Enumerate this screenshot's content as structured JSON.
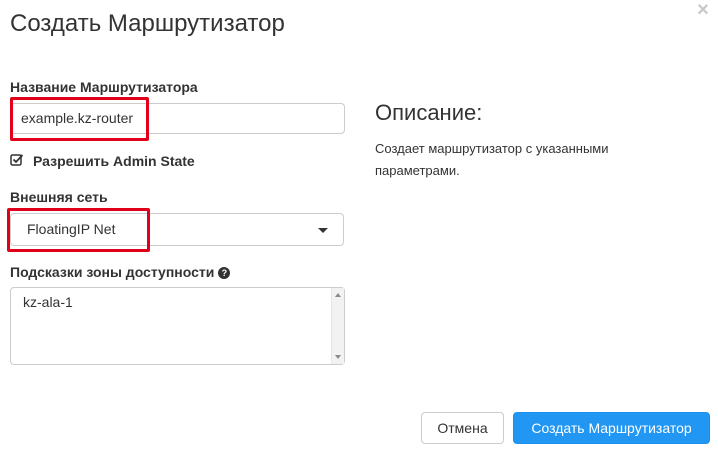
{
  "dialog": {
    "title": "Создать Маршрутизатор",
    "close_icon": "×"
  },
  "form": {
    "router_name": {
      "label": "Название Маршрутизатора",
      "value": "example.kz-router"
    },
    "admin_state": {
      "label": "Разрешить Admin State",
      "checked": true
    },
    "external_network": {
      "label": "Внешняя сеть",
      "selected": "FloatingIP Net"
    },
    "availability_zone_hints": {
      "label": "Подсказки зоны доступности",
      "options": [
        "kz-ala-1"
      ]
    }
  },
  "description": {
    "title": "Описание:",
    "text": "Создает маршрутизатор с указанными параметрами."
  },
  "buttons": {
    "cancel": "Отмена",
    "create": "Создать Маршрутизатор"
  },
  "colors": {
    "highlight": "#e0001b",
    "primary": "#2196f3"
  }
}
